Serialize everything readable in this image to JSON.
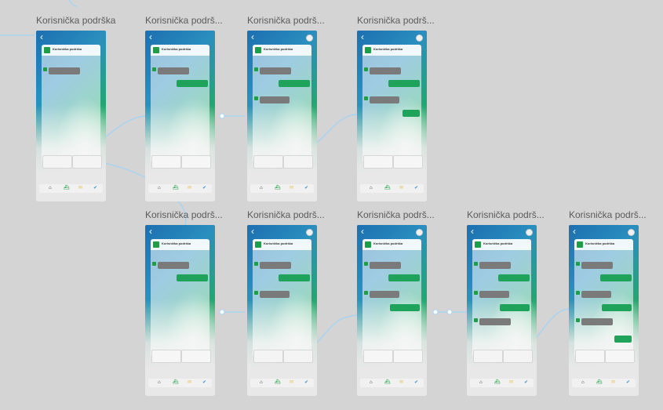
{
  "canvas": {
    "background": "#d4d4d4",
    "accent_green": "#1e9e46",
    "accent_blue": "#1d6fb0",
    "wire_color": "#a9d3ef"
  },
  "frames": [
    {
      "title": "Korisnička podrška",
      "chat_header": "Korisnička podrška",
      "avatar": false,
      "nav_icons": [
        "home-icon",
        "ship-icon",
        "mail-icon",
        "check-icon"
      ]
    },
    {
      "title": "Korisnička podrš...",
      "chat_header": "Korisnička podrška",
      "avatar": false,
      "nav_icons": [
        "home-icon",
        "ship-icon",
        "mail-icon",
        "check-icon"
      ]
    },
    {
      "title": "Korisnička podrš...",
      "chat_header": "Korisnička podrška",
      "avatar": true,
      "nav_icons": [
        "home-icon",
        "ship-icon",
        "mail-icon",
        "check-icon"
      ]
    },
    {
      "title": "Korisnička podrš...",
      "chat_header": "Korisnička podrška",
      "avatar": true,
      "nav_icons": [
        "home-icon",
        "ship-icon",
        "mail-icon",
        "check-icon"
      ]
    },
    {
      "title": "Korisnička podrš...",
      "chat_header": "Korisnička podrška",
      "avatar": false,
      "nav_icons": [
        "home-icon",
        "ship-icon",
        "mail-icon",
        "check-icon"
      ]
    },
    {
      "title": "Korisnička podrš...",
      "chat_header": "Korisnička podrška",
      "avatar": true,
      "nav_icons": [
        "home-icon",
        "ship-icon",
        "mail-icon",
        "check-icon"
      ]
    },
    {
      "title": "Korisnička podrš...",
      "chat_header": "Korisnička podrška",
      "avatar": true,
      "nav_icons": [
        "home-icon",
        "ship-icon",
        "mail-icon",
        "check-icon"
      ]
    },
    {
      "title": "Korisnička podrš...",
      "chat_header": "Korisnička podrška",
      "avatar": true,
      "nav_icons": [
        "home-icon",
        "ship-icon",
        "mail-icon",
        "check-icon"
      ]
    },
    {
      "title": "Korisnička podrš...",
      "chat_header": "Korisnička podrška",
      "avatar": true,
      "nav_icons": [
        "home-icon",
        "ship-icon",
        "mail-icon",
        "check-icon"
      ]
    }
  ]
}
